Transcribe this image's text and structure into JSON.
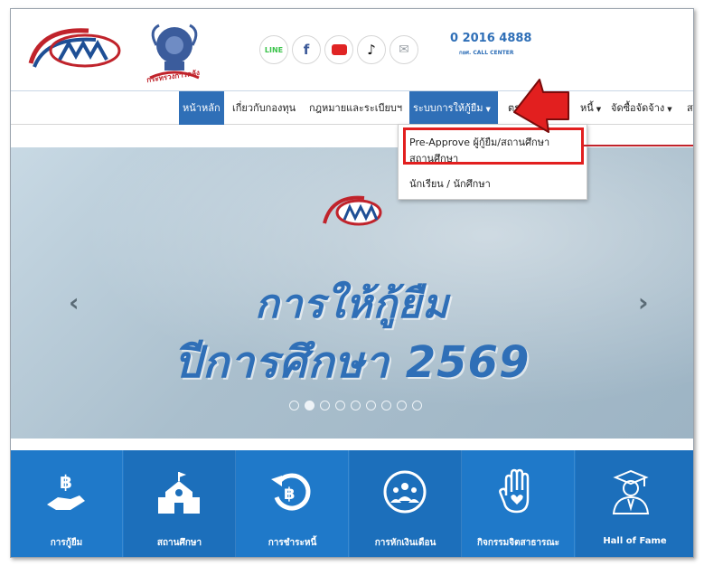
{
  "header": {
    "phone": "0 2016 4888",
    "callcenter": "กยศ. CALL CENTER",
    "ministry_tag": "กระทรวงการคลัง",
    "social": [
      {
        "name": "line-icon",
        "label": "LINE",
        "color": "#3ac34a"
      },
      {
        "name": "facebook-icon",
        "label": "f",
        "color": "#3b5998"
      },
      {
        "name": "youtube-icon",
        "label": "▶",
        "color": "#e02424"
      },
      {
        "name": "tiktok-icon",
        "label": "♪",
        "color": "#111111"
      },
      {
        "name": "mail-icon",
        "label": "✉",
        "color": "#9aa0a6"
      }
    ]
  },
  "nav": {
    "items": [
      {
        "label": "หน้าหลัก",
        "active": true
      },
      {
        "label": "เกี่ยวกับกองทุน"
      },
      {
        "label": "กฎหมายและระเบียบฯ"
      },
      {
        "label": "ระบบการให้กู้ยืม",
        "caret": true,
        "open": true
      },
      {
        "label": "ตร",
        "partial": true
      },
      {
        "label": "หนี้",
        "caret": true,
        "partial": true
      },
      {
        "label": "จัดซื้อจัดจ้าง",
        "caret": true
      },
      {
        "label": "ส"
      }
    ]
  },
  "dropdown": {
    "items": [
      "Pre-Approve ผู้กู้ยืม/สถานศึกษา",
      "สถานศึกษา",
      "นักเรียน / นักศึกษา"
    ]
  },
  "hero": {
    "line1": "การให้กู้ยืม",
    "line2": "ปีการศึกษา 2569",
    "prev": "‹",
    "next": "›",
    "slide_count": 9,
    "active_slide": 2
  },
  "tiles": [
    {
      "name": "loan-icon",
      "label": "การกู้ยืม"
    },
    {
      "name": "school-icon",
      "label": "สถานศึกษา"
    },
    {
      "name": "repayment-icon",
      "label": "การชำระหนี้"
    },
    {
      "name": "salary-deduction-icon",
      "label": "การหักเงินเดือน"
    },
    {
      "name": "volunteer-icon",
      "label": "กิจกรรมจิตสาธารณะ"
    },
    {
      "name": "graduate-icon",
      "label": "Hall of Fame"
    }
  ],
  "colors": {
    "brand_blue": "#2f6fb7",
    "tile_blue": "#1f79c9",
    "highlight_red": "#e21f1f"
  }
}
